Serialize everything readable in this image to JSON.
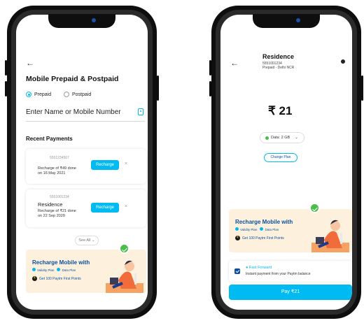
{
  "colors": {
    "accent": "#00baf2",
    "brand_navy": "#0b4f9e",
    "success": "#4bbd4b",
    "banner_bg": "#fdf1dd"
  },
  "left_screen": {
    "back_icon": "←",
    "title": "Mobile Prepaid & Postpaid",
    "radio_prepaid": "Prepaid",
    "radio_postpaid": "Postpaid",
    "selected_type": "Prepaid",
    "input_label": "Enter Name or Mobile Number",
    "recent_heading": "Recent Payments",
    "payments": [
      {
        "number": "5551234567",
        "name": "",
        "desc_line1": "Recharge of ₹49 done",
        "desc_line2": "on 16 May 2021",
        "button": "Recharge",
        "dismiss": "×"
      },
      {
        "number": "5551001234",
        "name": "Residence",
        "desc_line1": "Recharge of ₹21 done",
        "desc_line2": "on 22 Sep 2020",
        "button": "Recharge",
        "dismiss": "×"
      }
    ],
    "see_all": "See All ⌄",
    "banner": {
      "heading": "Recharge Mobile with",
      "tag1": "Validity Plan",
      "tag2": "Data Plan",
      "coin": "₹",
      "points": "Get 100 Paytm First Points"
    }
  },
  "right_screen": {
    "back_icon": "←",
    "contact_name": "Residence",
    "contact_number": "5551001234",
    "contact_circle": "Prepaid - Delhi NCR",
    "amount": "₹ 21",
    "plan_pill": "Data: 2 GB",
    "pill_chevron": "⌄",
    "change_plan": "Change Plan",
    "banner": {
      "heading": "Recharge Mobile with",
      "tag1": "Validity Plan",
      "tag2": "Data Plan",
      "coin": "₹",
      "points": "Get 100 Paytm First Points"
    },
    "fast_forward_title": "● Fast Forward",
    "fast_forward_sub": "Instant payment from your Paytm balance",
    "pay_button": "Pay ₹21"
  }
}
